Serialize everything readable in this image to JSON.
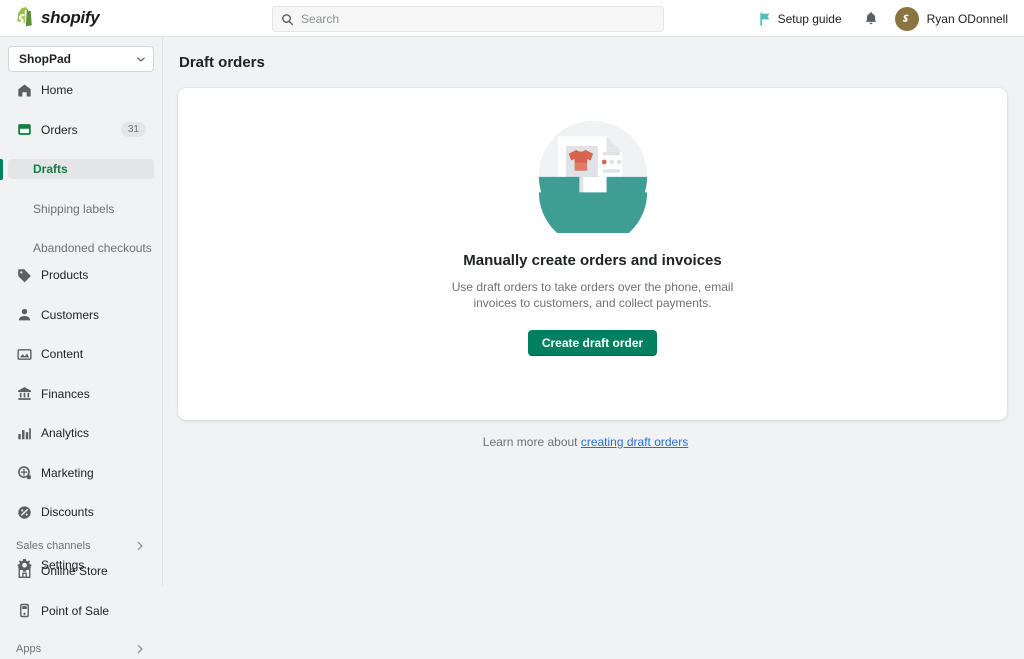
{
  "topbar": {
    "brand_name": "shopify",
    "brand_icon": "shopify-bag-icon",
    "search": {
      "placeholder": "Search",
      "value": "",
      "icon": "search-icon"
    },
    "setup_guide": {
      "label": "Setup guide",
      "icon": "flag-icon",
      "icon_color": "#47C1BF"
    },
    "notifications": {
      "icon": "bell-icon"
    },
    "user": {
      "name": "Ryan ODonnell",
      "avatar_initial": "S",
      "avatar_color": "#8a7441"
    }
  },
  "sidebar": {
    "store": {
      "name": "ShopPad",
      "icon": "chevron-down-icon"
    },
    "items": [
      {
        "label": "Home",
        "icon": "home-icon",
        "badge": "",
        "selected": false
      },
      {
        "label": "Orders",
        "icon": "orders-icon",
        "badge": "31",
        "selected": false,
        "active_section": true
      },
      {
        "label": "Products",
        "icon": "products-tag-icon",
        "badge": "",
        "selected": false
      },
      {
        "label": "Customers",
        "icon": "customers-icon",
        "badge": "",
        "selected": false
      },
      {
        "label": "Content",
        "icon": "content-icon",
        "badge": "",
        "selected": false
      },
      {
        "label": "Finances",
        "icon": "finances-bank-icon",
        "badge": "",
        "selected": false
      },
      {
        "label": "Analytics",
        "icon": "analytics-bars-icon",
        "badge": "",
        "selected": false
      },
      {
        "label": "Marketing",
        "icon": "marketing-megaphone-icon",
        "badge": "",
        "selected": false
      },
      {
        "label": "Discounts",
        "icon": "discounts-icon",
        "badge": "",
        "selected": false
      }
    ],
    "sub_items": [
      {
        "label": "Drafts",
        "selected": true
      },
      {
        "label": "Shipping labels",
        "selected": false
      },
      {
        "label": "Abandoned checkouts",
        "selected": false
      }
    ],
    "sales_channels": {
      "title": "Sales channels",
      "chevron": "chevron-right-icon",
      "items": [
        {
          "label": "Online Store",
          "icon": "store-icon"
        },
        {
          "label": "Point of Sale",
          "icon": "pos-icon"
        }
      ]
    },
    "apps": {
      "title": "Apps",
      "chevron": "chevron-right-icon"
    },
    "settings": {
      "label": "Settings",
      "icon": "gear-icon"
    }
  },
  "main": {
    "page_title": "Draft orders",
    "empty_state": {
      "illustration": "draft-order-document-illustration",
      "title": "Manually create orders and invoices",
      "body": "Use draft orders to take orders over the phone, email invoices to customers, and collect payments.",
      "primary_action": "Create draft order"
    },
    "footer": {
      "prefix": "Learn more about ",
      "link_text": "creating draft orders"
    }
  },
  "colors": {
    "brand_green": "#008060",
    "selected_green": "#108043",
    "link_blue": "#2c6ecb",
    "teal_accent": "#47C1BF",
    "page_bg": "#f1f2f3",
    "card_bg": "#ffffff"
  }
}
